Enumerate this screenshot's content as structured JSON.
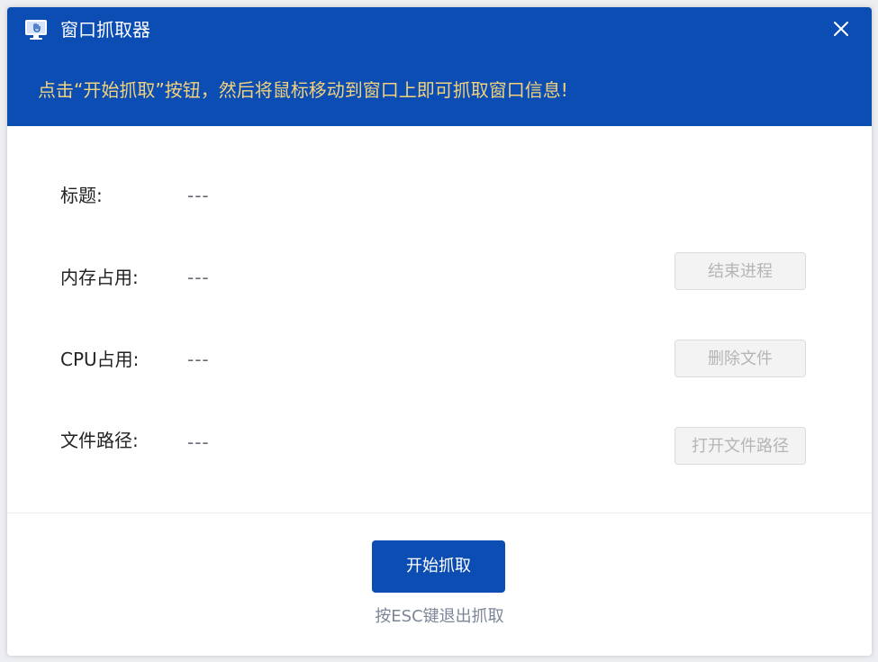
{
  "window": {
    "title": "窗口抓取器",
    "hint": "点击“开始抓取”按钮，然后将鼠标移动到窗口上即可抓取窗口信息!",
    "close_icon": "close-icon",
    "app_icon": "monitor-hand-icon"
  },
  "info": {
    "title_label": "标题:",
    "title_value": "---",
    "memory_label": "内存占用:",
    "memory_value": "---",
    "cpu_label": "CPU占用:",
    "cpu_value": "---",
    "path_label": "文件路径:",
    "path_value": "---"
  },
  "actions": {
    "end_process": "结束进程",
    "delete_file": "删除文件",
    "open_path": "打开文件路径"
  },
  "footer": {
    "start_label": "开始抓取",
    "esc_hint": "按ESC键退出抓取"
  },
  "colors": {
    "header": "#0b4db3",
    "hint": "#f3d27b",
    "primary_button": "#0b4db3",
    "disabled_button_bg": "#f3f3f3",
    "disabled_button_text": "#b5b5b5"
  }
}
